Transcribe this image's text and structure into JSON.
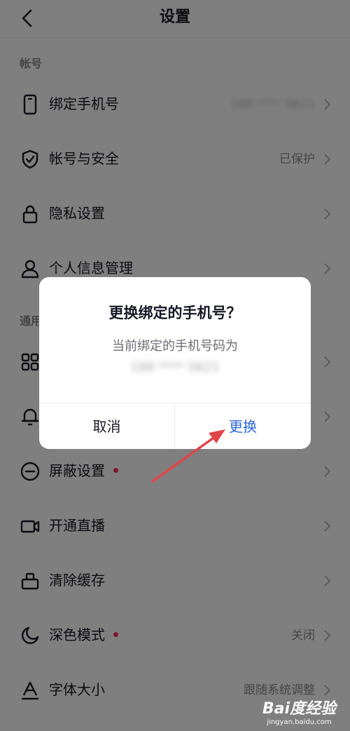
{
  "nav": {
    "title": "设置"
  },
  "sections": {
    "account": "帐号",
    "general": "通用"
  },
  "rows": [
    {
      "label": "绑定手机号",
      "value": "188 **** 5621",
      "icon": "phone-icon"
    },
    {
      "label": "帐号与安全",
      "value": "已保护",
      "icon": "shield-icon"
    },
    {
      "label": "隐私设置",
      "value": "",
      "icon": "lock-icon"
    },
    {
      "label": "个人信息管理",
      "value": "",
      "icon": "user-icon"
    },
    {
      "label": "",
      "value": "",
      "icon": "grid-icon"
    },
    {
      "label": "",
      "value": "",
      "icon": "bell-icon"
    },
    {
      "label": "屏蔽设置",
      "value": "",
      "icon": "block-icon",
      "dot": true
    },
    {
      "label": "开通直播",
      "value": "",
      "icon": "video-camera-icon"
    },
    {
      "label": "清除缓存",
      "value": "",
      "icon": "broom-icon"
    },
    {
      "label": "深色模式",
      "value": "关闭",
      "icon": "moon-icon",
      "dot": true
    },
    {
      "label": "字体大小",
      "value": "跟随系统调整",
      "icon": "font-icon"
    }
  ],
  "dialog": {
    "title": "更换绑定的手机号？",
    "message": "当前绑定的手机号码为",
    "phone": "188 **** 5621",
    "cancel": "取消",
    "confirm": "更换"
  },
  "watermark": {
    "logo": "Bai度经验",
    "url": "jingyan.baidu.com"
  },
  "colors": {
    "accent": "#2e67d8",
    "dot": "#fe2c55",
    "annotation_arrow": "#e0454a"
  }
}
